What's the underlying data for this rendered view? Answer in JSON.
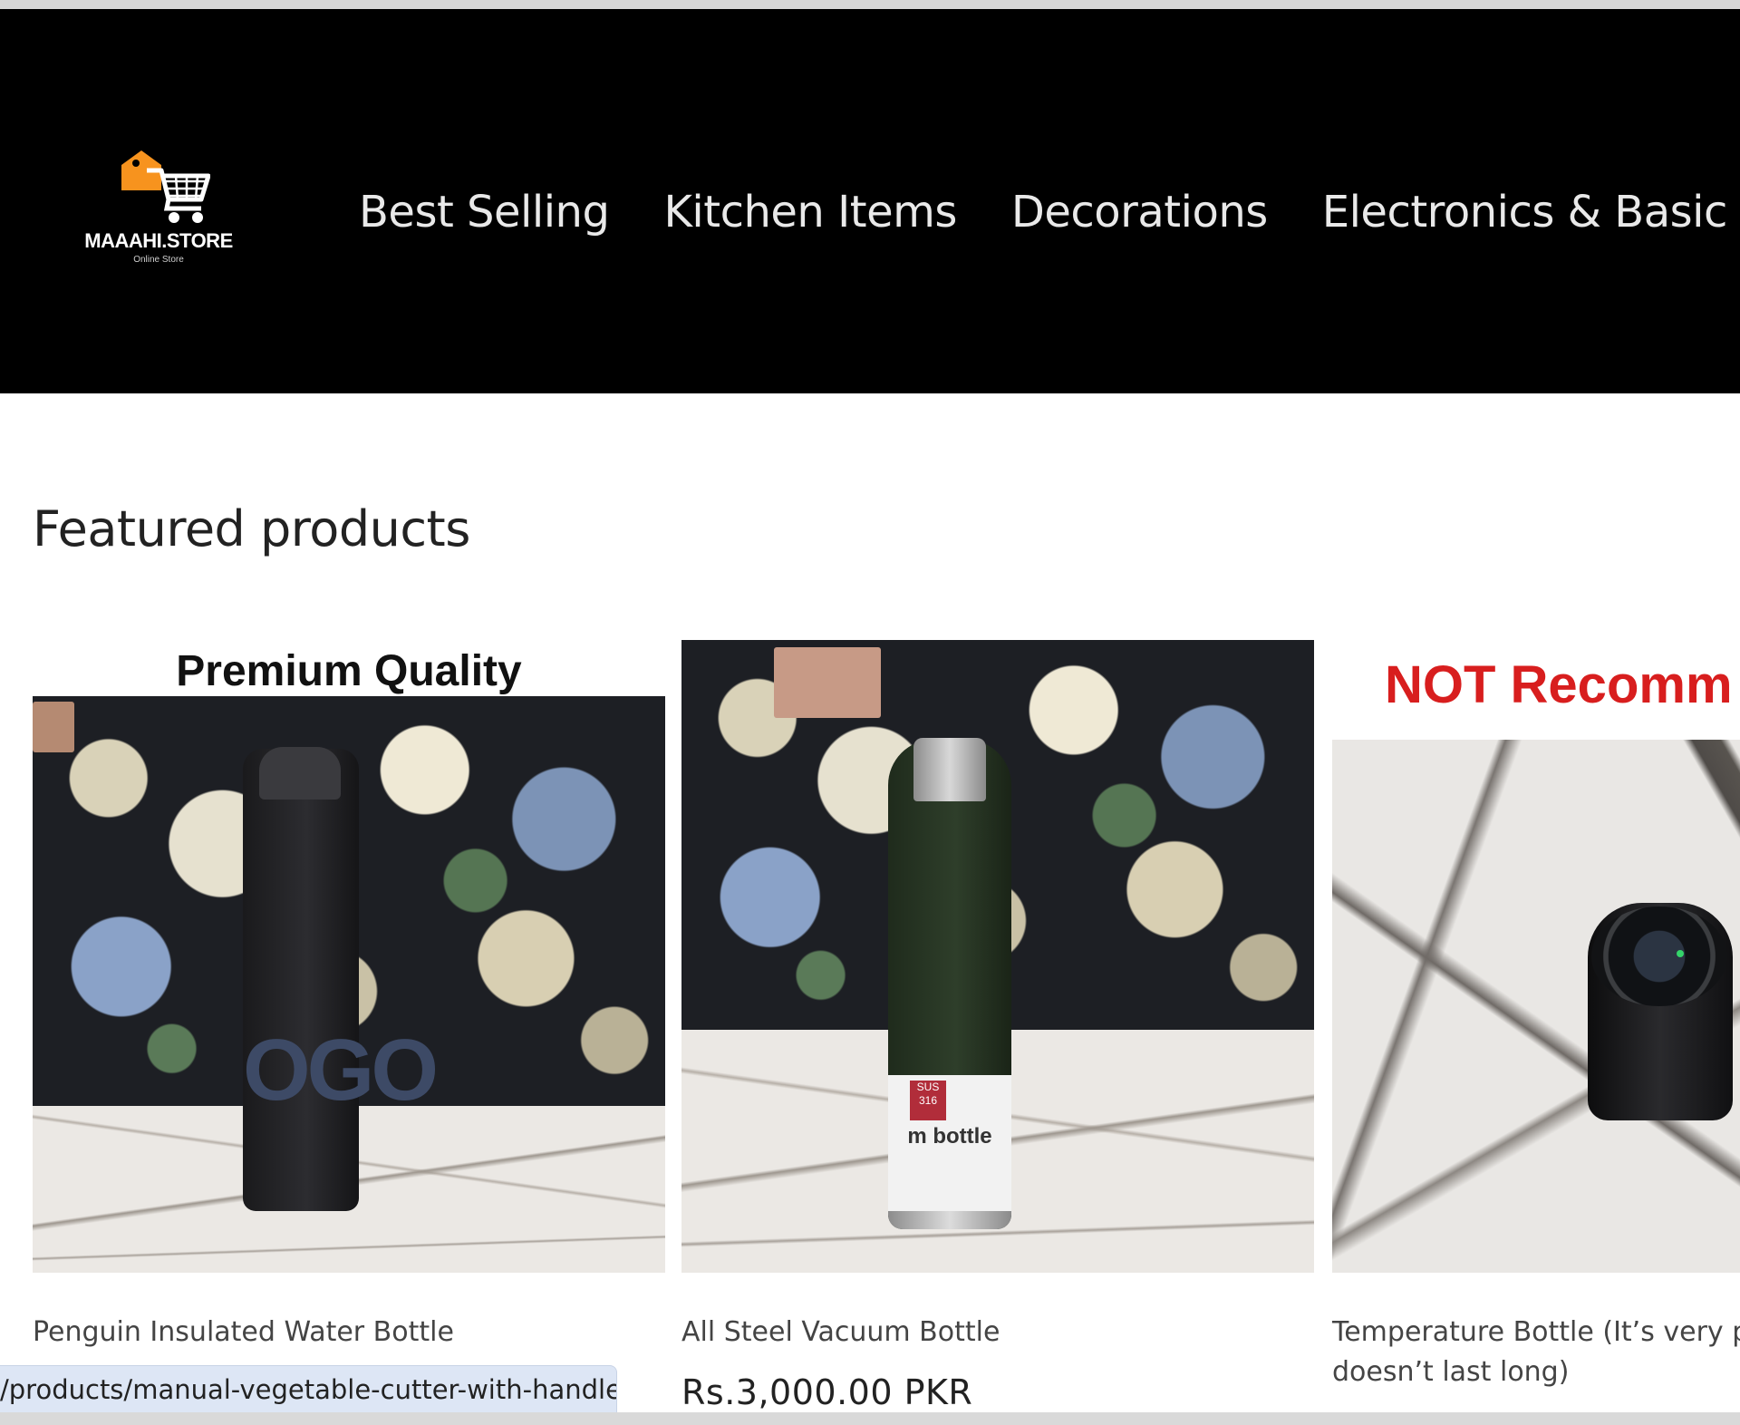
{
  "brand": {
    "name": "MAAAHI.STORE",
    "tagline": "Online Store",
    "accent": "#f7931e"
  },
  "nav": {
    "items": [
      {
        "label": "Best Selling"
      },
      {
        "label": "Kitchen Items"
      },
      {
        "label": "Decorations"
      },
      {
        "label": "Electronics & Basic ite"
      }
    ]
  },
  "section": {
    "title": "Featured products"
  },
  "products": [
    {
      "name": "Penguin Insulated Water Bottle",
      "image_banner": "Premium Quality",
      "bottle_print": "OGO",
      "image_icon": "bottle-image-icon"
    },
    {
      "name": "All Steel Vacuum Bottle",
      "price": "Rs.3,000.00 PKR",
      "label_badge": "SUS 316",
      "label_text": "m bottle",
      "image_icon": "bottle-image-icon"
    },
    {
      "name_line1": "Temperature Bottle (It’s very p",
      "name_line2": "doesn’t last long)",
      "image_banner": "NOT Recomm",
      "banner_color": "#d81e1e",
      "image_icon": "bottle-image-icon"
    }
  ],
  "status_bar": {
    "url": "/products/manual-vegetable-cutter-with-handle"
  }
}
